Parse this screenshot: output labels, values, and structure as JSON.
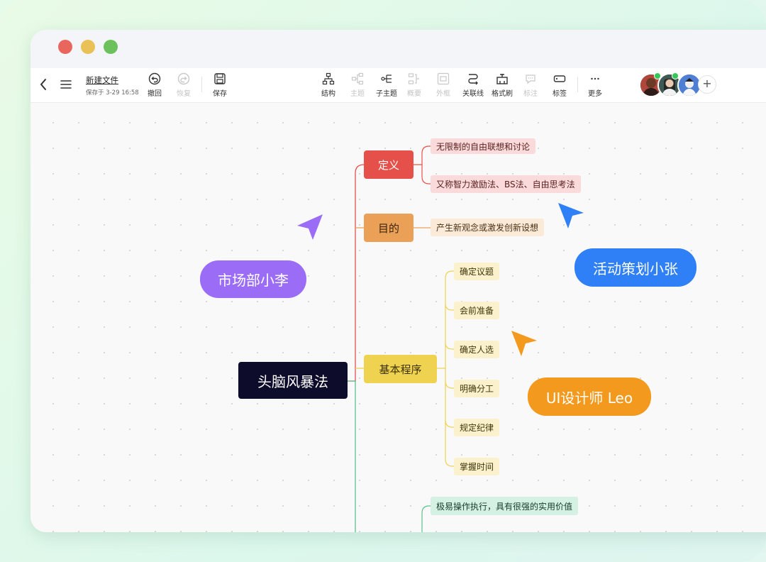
{
  "toolbar": {
    "file_title": "新建文件",
    "saved_meta": "保存于 3-29 16:58",
    "undo": "撤回",
    "redo": "恢复",
    "save": "保存",
    "structure": "结构",
    "topic": "主题",
    "subtopic": "子主题",
    "summary": "概要",
    "frame": "外框",
    "relation": "关联线",
    "format_painter": "格式刷",
    "note": "标注",
    "tag": "标签",
    "more": "更多",
    "add_collaborator": "+"
  },
  "mindmap": {
    "root": "头脑风暴法",
    "definition": "定义",
    "definition_leaf_1": "无限制的自由联想和讨论",
    "definition_leaf_2": "又称智力激励法、BS法、自由思考法",
    "purpose": "目的",
    "purpose_leaf_1": "产生新观念或激发创新设想",
    "procedure": "基本程序",
    "procedure_leaves": [
      "确定议题",
      "会前准备",
      "确定人选",
      "明确分工",
      "规定纪律",
      "掌握时间"
    ],
    "feature_leaf_1": "极易操作执行，具有很强的实用价值"
  },
  "collaborators": {
    "user_1": "市场部小李",
    "user_2": "活动策划小张",
    "user_3": "UI设计师 Leo"
  },
  "colors": {
    "root_bg": "#0e0c2b",
    "definition": "#e5514a",
    "purpose": "#eba057",
    "procedure": "#f0d251",
    "feature_line": "#5cbf8f",
    "user_1": "#9b6cf6",
    "user_2": "#2f80f6",
    "user_3": "#f39a1e"
  }
}
